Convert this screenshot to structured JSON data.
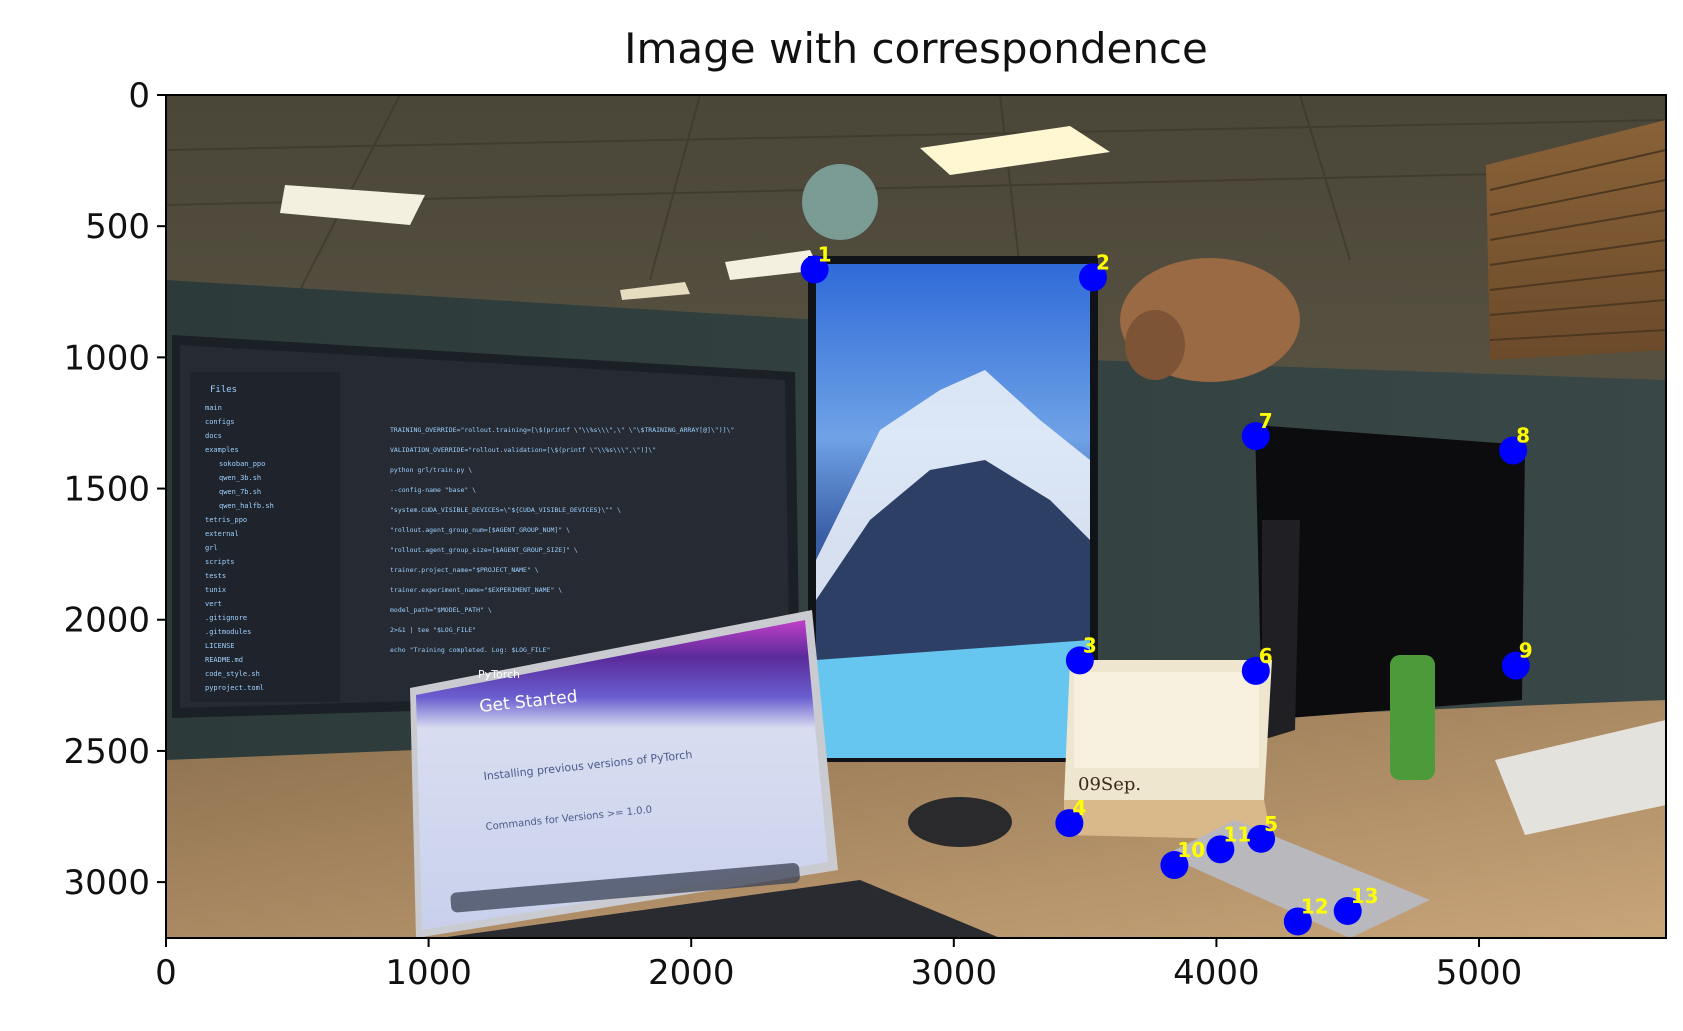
{
  "chart_data": {
    "type": "scatter",
    "title": "Image with correspondence",
    "xlabel": "",
    "ylabel": "",
    "xlim": [
      0,
      5712
    ],
    "ylim": [
      3213,
      0
    ],
    "y_inverted": true,
    "grid": false,
    "x_ticks": [
      0,
      1000,
      2000,
      3000,
      4000,
      5000
    ],
    "y_ticks": [
      0,
      500,
      1000,
      1500,
      2000,
      2500,
      3000
    ],
    "background": "photo",
    "marker_color": "#0000ff",
    "label_color": "#ffff00",
    "points": [
      {
        "label": "1",
        "x": 2470,
        "y": 665
      },
      {
        "label": "2",
        "x": 3530,
        "y": 695
      },
      {
        "label": "3",
        "x": 3480,
        "y": 2155
      },
      {
        "label": "4",
        "x": 3440,
        "y": 2775
      },
      {
        "label": "5",
        "x": 4170,
        "y": 2835
      },
      {
        "label": "6",
        "x": 4150,
        "y": 2195
      },
      {
        "label": "7",
        "x": 4150,
        "y": 1300
      },
      {
        "label": "8",
        "x": 5130,
        "y": 1355
      },
      {
        "label": "9",
        "x": 5140,
        "y": 2175
      },
      {
        "label": "10",
        "x": 3840,
        "y": 2935
      },
      {
        "label": "11",
        "x": 4015,
        "y": 2875
      },
      {
        "label": "12",
        "x": 4310,
        "y": 3150
      },
      {
        "label": "13",
        "x": 4500,
        "y": 3110
      }
    ],
    "scene": {
      "laptop_text": [
        "PyTorch",
        "Get Started",
        "Installing previous versions of PyTorch",
        "Commands for Versions >= 1.0.0"
      ],
      "calendar_text": "09Sep.",
      "sidebar_header": "Files",
      "sidebar_items": [
        "main",
        "configs",
        "docs",
        "examples",
        "sokoban_ppo",
        "qwen_3b.sh",
        "qwen_7b.sh",
        "qwen_halfb.sh",
        "tetris_ppo",
        "external",
        "grl",
        "scripts",
        "tests",
        "tunix",
        "vert",
        ".gitignore",
        ".gitmodules",
        "LICENSE",
        "README.md",
        "code_style.sh",
        "pyproject.toml"
      ],
      "code_lines": [
        "TRAINING_OVERRIDE=\"rollout.training=[\\$(printf \\\"\\\\%s\\\\\\\",\\\" \\\"\\$TRAINING_ARRAY[@]\\\")]\\\"",
        "VALIDATION_OVERRIDE=\"rollout.validation=[\\$(printf \\\"\\\\%s\\\\\\\",\\\")]\\\"",
        "python grl/train.py \\",
        "  --config-name \"base\" \\",
        "  \"system.CUDA_VISIBLE_DEVICES=\\\"${CUDA_VISIBLE_DEVICES}\\\"\" \\",
        "  \"rollout.agent_group_num=[$AGENT_GROUP_NUM]\" \\",
        "  \"rollout.agent_group_size=[$AGENT_GROUP_SIZE]\" \\",
        "  trainer.project_name=\"$PROJECT_NAME\" \\",
        "  trainer.experiment_name=\"$EXPERIMENT_NAME\" \\",
        "  model_path=\"$MODEL_PATH\" \\",
        "  2>&1 | tee \"$LOG_FILE\"",
        "echo \"Training completed. Log: $LOG_FILE\""
      ]
    }
  }
}
